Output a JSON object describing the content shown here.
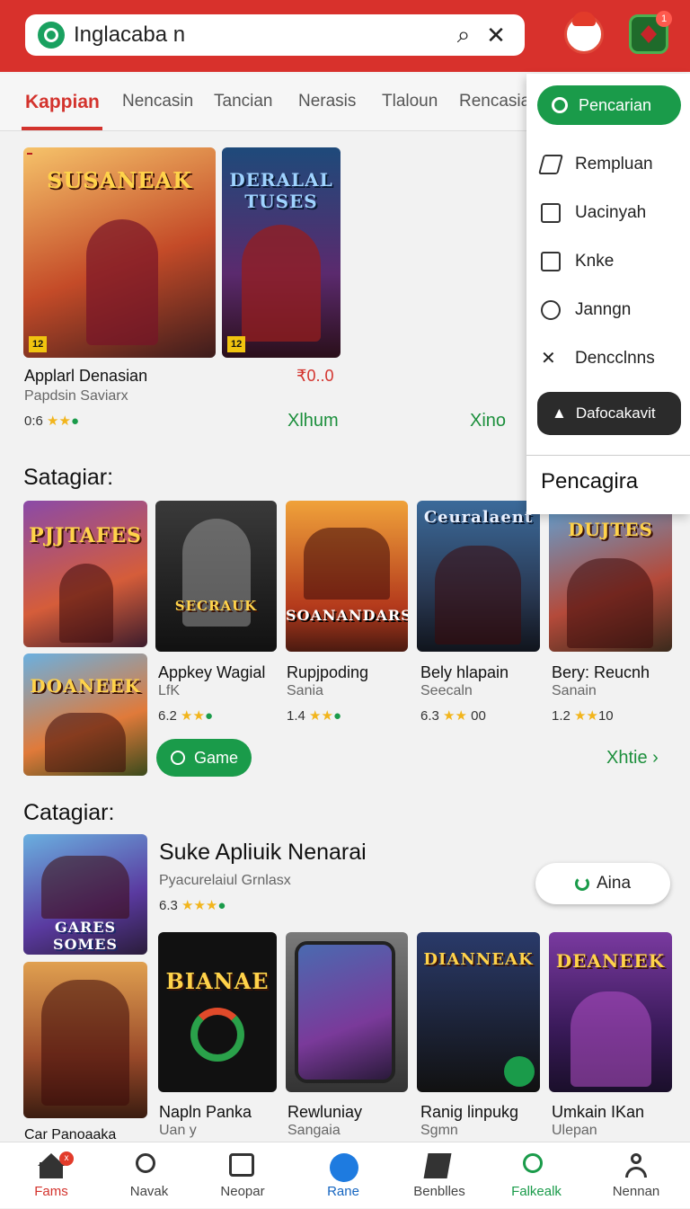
{
  "search": {
    "query": "Inglacaba n"
  },
  "header": {
    "notification_count": "1"
  },
  "tabs": [
    "Kappian",
    "Nencasin",
    "Tancian",
    "Nerasis",
    "Tlaloun",
    "Rencasia"
  ],
  "featured": {
    "card1": {
      "art_title": "SUSANEAK",
      "badge": "12"
    },
    "card2": {
      "art_title": "DERALAL TUSES",
      "badge": "12"
    },
    "title": "Applarl Denasian",
    "subtitle": "Papdsin Saviarx",
    "rating": "0:6",
    "price": "₹0..0",
    "link1": "Xlhum",
    "link2": "Xino"
  },
  "section1": {
    "title": "Satagiar:",
    "thumb_titles": [
      "PJJTAFES",
      "SECRAUK",
      "SOANANDARS",
      "Ceuralaent",
      "DUJTES",
      "DOANEEK"
    ],
    "apps": [
      {
        "title": "Appkey Wagial",
        "subtitle": "LfK",
        "rating": "6.2"
      },
      {
        "title": "Rupjpoding",
        "subtitle": "Sania",
        "rating": "1.4"
      },
      {
        "title": "Bely hlapain",
        "subtitle": "Seecaln",
        "rating": "6.3",
        "count": "00"
      },
      {
        "title": "Bery: Reucnh",
        "subtitle": "Sanain",
        "rating": "1.2",
        "count": "10"
      }
    ],
    "game_button": "Game",
    "more_link": "Xhtie"
  },
  "section2": {
    "title": "Catagiar:",
    "feature_title": "Suke Apliuik Nenarai",
    "feature_subtitle": "Pyacurelaiul Grnlasx",
    "feature_rating": "6.3",
    "aina_button": "Aina",
    "thumb_titles": [
      "GARES SOMES",
      "",
      "BIANAE",
      "",
      "DIANNEAK",
      "DEANEEK"
    ],
    "apps": [
      {
        "title": "Napln Panka",
        "subtitle": "Uan y"
      },
      {
        "title": "Rewluniay",
        "subtitle": "Sangaia"
      },
      {
        "title": "Ranig linpukg",
        "subtitle": "Sgmn"
      },
      {
        "title": "Umkain IKan",
        "subtitle": "Ulepan"
      }
    ],
    "cut_label": "Car Panoaaka"
  },
  "dropdown": {
    "primary": "Pencarian",
    "items": [
      "Rempluan",
      "Uacinyah",
      "Knke",
      "Janngn",
      "Dencclnns"
    ],
    "dark_button": "Dafocakavit",
    "footer": "Pencagira"
  },
  "bottom_nav": [
    "Fams",
    "Navak",
    "Neopar",
    "Rane",
    "Benblles",
    "Falkealk",
    "Nennan"
  ],
  "colors": {
    "brand_red": "#d8312c",
    "accent_green": "#1a9b4a"
  }
}
